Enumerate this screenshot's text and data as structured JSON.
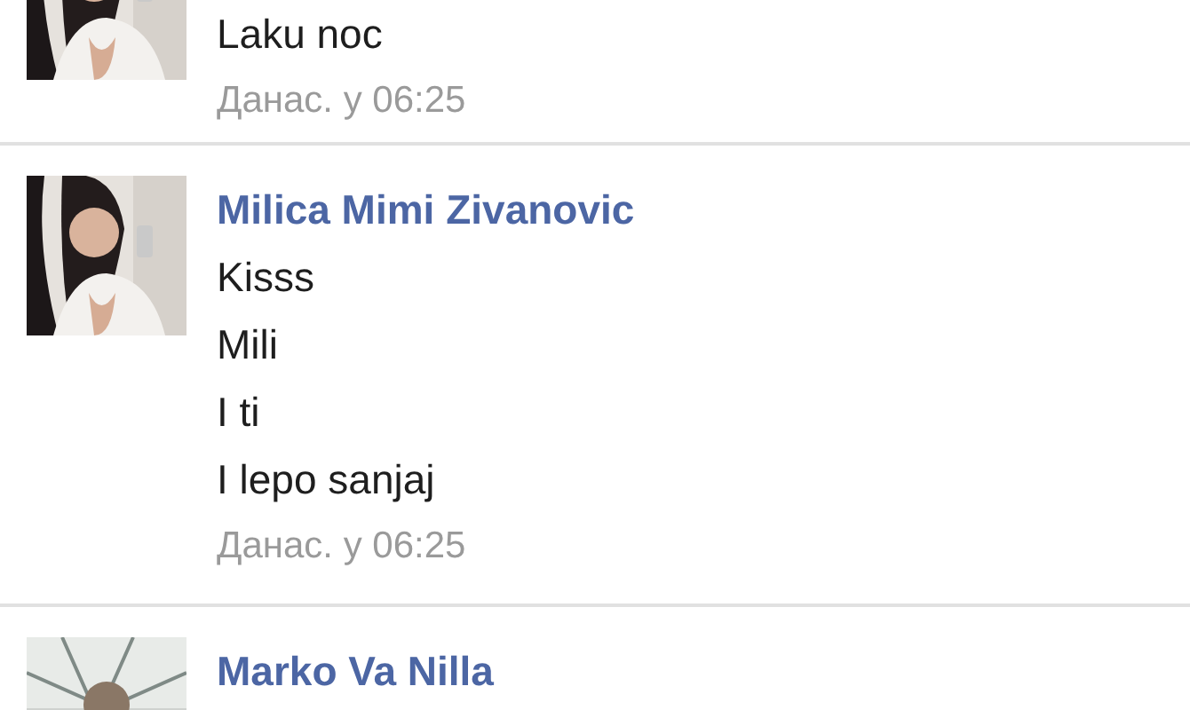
{
  "comments": [
    {
      "lines": [
        "Laku noc"
      ],
      "time": "Данас. у 06:25"
    },
    {
      "author": "Milica Mimi Zivanovic",
      "lines": [
        "Kisss",
        "Mili",
        "I ti",
        "I lepo sanjaj"
      ],
      "time": "Данас. у 06:25"
    },
    {
      "author": "Marko Va Nilla"
    }
  ]
}
